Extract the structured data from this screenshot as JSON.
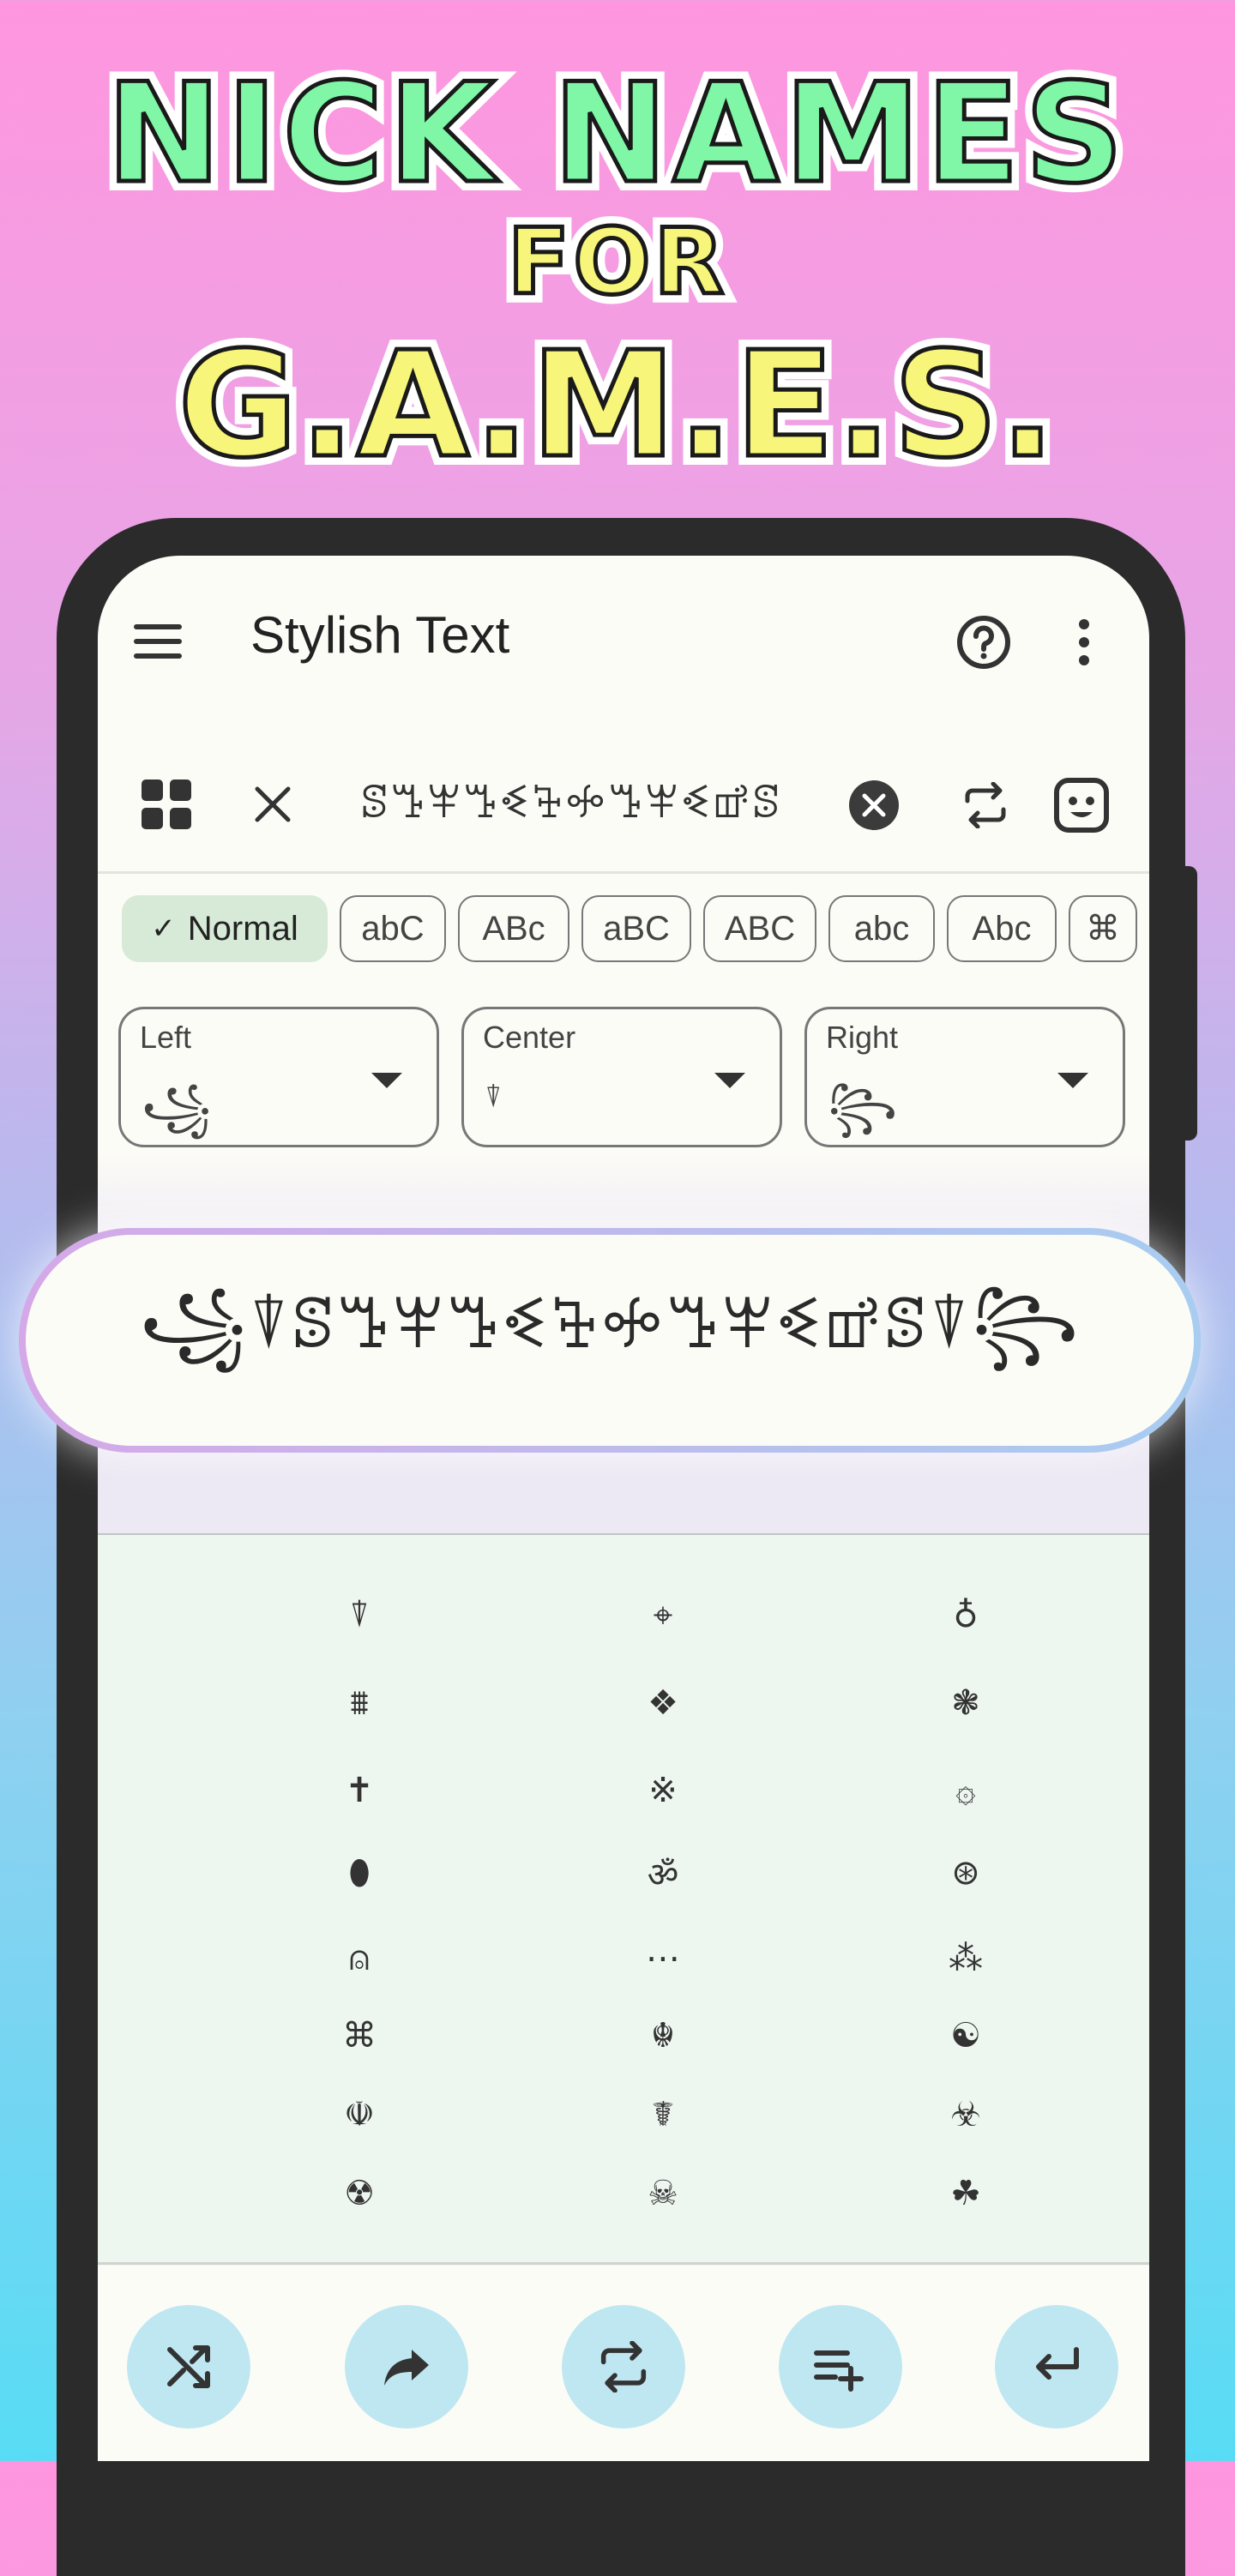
{
  "headline": {
    "line1": "NICK NAMES",
    "line2": "FOR",
    "line3": "G.A.M.E.S."
  },
  "app": {
    "title": "Stylish Text"
  },
  "input": {
    "value": "ꕷꔤꕽꔤꔽꕳꖢꔤꕽꔽꕡꕷ"
  },
  "chips": [
    "Normal",
    "abC",
    "ABc",
    "aBC",
    "ABC",
    "abc",
    "Abc",
    "⌘"
  ],
  "dropdowns": [
    {
      "label": "Left",
      "value": "꧁"
    },
    {
      "label": "Center",
      "value": "⍒"
    },
    {
      "label": "Right",
      "value": "꧂"
    }
  ],
  "preview": {
    "text": "꧁⍒ꕷꔤꕽꔤꔽꕳꖢꔤꕽꔽꕡꕷ⍒꧂"
  },
  "symbols": [
    [
      "⍒",
      "⌖",
      "♁"
    ],
    [
      "⩩",
      "❖",
      "❃"
    ],
    [
      "✝",
      "※",
      "۞"
    ],
    [
      "⬮",
      "ॐ",
      "⊛"
    ],
    [
      "⍝",
      "⋯",
      "⁂"
    ],
    [
      "⌘",
      "☬",
      "☯"
    ],
    [
      "☫",
      "☤",
      "☣"
    ],
    [
      "☢",
      "☠",
      "☘"
    ]
  ],
  "colors": {
    "accent": "#d7ead7",
    "fab": "#bfe7f2"
  }
}
